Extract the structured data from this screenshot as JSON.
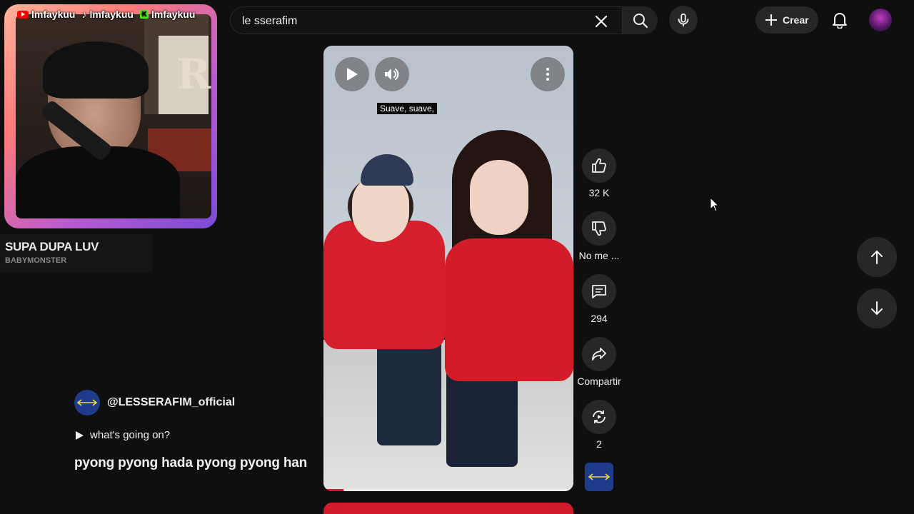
{
  "search": {
    "query": "le sserafim"
  },
  "header": {
    "create_label": "Crear"
  },
  "overlay": {
    "socials": [
      {
        "platform": "youtube",
        "handle": "lmfaykuu"
      },
      {
        "platform": "tiktok",
        "handle": "lmfaykuu"
      },
      {
        "platform": "kick",
        "handle": "lmfaykuu"
      }
    ],
    "cam_letter": "R",
    "music": {
      "title": "SUPA DUPA LUV",
      "artist": "BABYMONSTER"
    }
  },
  "short": {
    "subtitle": "Suave, suave,",
    "channel": "@LESSERAFIM_official",
    "description": "what's going on?",
    "caption": "pyong pyong hada pyong pyong han",
    "progress": 0.08
  },
  "actions": {
    "like_count": "32 K",
    "dislike_label": "No me ...",
    "comment_count": "294",
    "share_label": "Compartir",
    "remix_count": "2"
  },
  "colors": {
    "accent": "#ff0033",
    "background": "#0f0f0f",
    "button_bg": "#272727"
  },
  "icons": [
    "clear-icon",
    "search-icon",
    "mic-icon",
    "plus-icon",
    "bell-icon",
    "play-icon",
    "volume-icon",
    "more-vert-icon",
    "thumb-up-icon",
    "thumb-down-icon",
    "comment-icon",
    "share-icon",
    "remix-icon",
    "arrow-up-icon",
    "arrow-down-icon",
    "cursor-icon"
  ]
}
